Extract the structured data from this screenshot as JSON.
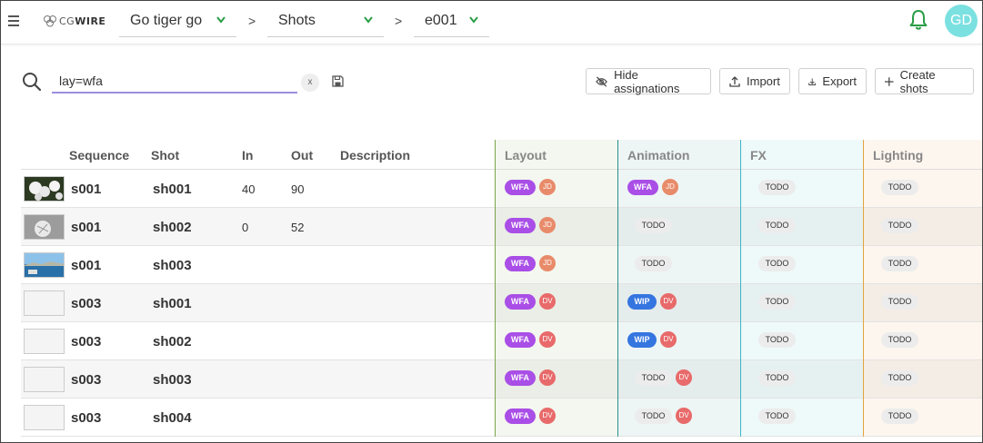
{
  "header": {
    "menu_icon": "hamburger-icon",
    "logo": {
      "prefix": "CG",
      "suffix": "WIRE",
      "icon": "logo-icon"
    },
    "production": "Go tiger go",
    "section": "Shots",
    "episode": "e001",
    "separator": ">",
    "avatar_initials": "GD",
    "colors": {
      "avatar": "#7be0e0",
      "bell": "#2a9d46",
      "chevron": "#2a9d46"
    }
  },
  "search": {
    "value": "lay=wfa",
    "clear_label": "x",
    "icon": "search-icon",
    "save_icon": "save-icon"
  },
  "toolbar": {
    "hide_assignations": "Hide assignations",
    "import": "Import",
    "export": "Export",
    "create_shots": "Create shots"
  },
  "columns": {
    "sequence": "Sequence",
    "shot": "Shot",
    "in": "In",
    "out": "Out",
    "description": "Description",
    "layout": "Layout",
    "animation": "Animation",
    "fx": "FX",
    "lighting": "Lighting"
  },
  "task_colors": {
    "layout": "#7ca34b",
    "animation": "#2a8f8f",
    "fx": "#3cb6c6",
    "lighting": "#e4a440"
  },
  "status_colors": {
    "WFA": "#a94ee6",
    "WIP": "#3575e0",
    "TODO": "#ececec"
  },
  "rows": [
    {
      "thumb": "flowers",
      "sequence": "s001",
      "shot": "sh001",
      "in": "40",
      "out": "90",
      "layout": {
        "status": "WFA",
        "person": "JD"
      },
      "animation": {
        "status": "WFA",
        "person": "JD"
      },
      "fx": {
        "status": "TODO",
        "person": ""
      },
      "lighting": {
        "status": "TODO",
        "person": ""
      }
    },
    {
      "thumb": "ice",
      "sequence": "s001",
      "shot": "sh002",
      "in": "0",
      "out": "52",
      "layout": {
        "status": "WFA",
        "person": "JD"
      },
      "animation": {
        "status": "TODO",
        "person": ""
      },
      "fx": {
        "status": "TODO",
        "person": ""
      },
      "lighting": {
        "status": "TODO",
        "person": ""
      }
    },
    {
      "thumb": "sea",
      "sequence": "s001",
      "shot": "sh003",
      "in": "",
      "out": "",
      "layout": {
        "status": "WFA",
        "person": "JD"
      },
      "animation": {
        "status": "TODO",
        "person": ""
      },
      "fx": {
        "status": "TODO",
        "person": ""
      },
      "lighting": {
        "status": "TODO",
        "person": ""
      }
    },
    {
      "thumb": "empty",
      "sequence": "s003",
      "shot": "sh001",
      "in": "",
      "out": "",
      "layout": {
        "status": "WFA",
        "person": "DV"
      },
      "animation": {
        "status": "WIP",
        "person": "DV"
      },
      "fx": {
        "status": "TODO",
        "person": ""
      },
      "lighting": {
        "status": "TODO",
        "person": ""
      }
    },
    {
      "thumb": "empty",
      "sequence": "s003",
      "shot": "sh002",
      "in": "",
      "out": "",
      "layout": {
        "status": "WFA",
        "person": "DV"
      },
      "animation": {
        "status": "WIP",
        "person": "DV"
      },
      "fx": {
        "status": "TODO",
        "person": ""
      },
      "lighting": {
        "status": "TODO",
        "person": ""
      }
    },
    {
      "thumb": "empty",
      "sequence": "s003",
      "shot": "sh003",
      "in": "",
      "out": "",
      "layout": {
        "status": "WFA",
        "person": "DV"
      },
      "animation": {
        "status": "TODO",
        "person": "DV"
      },
      "fx": {
        "status": "TODO",
        "person": ""
      },
      "lighting": {
        "status": "TODO",
        "person": ""
      }
    },
    {
      "thumb": "empty",
      "sequence": "s003",
      "shot": "sh004",
      "in": "",
      "out": "",
      "layout": {
        "status": "WFA",
        "person": "DV"
      },
      "animation": {
        "status": "TODO",
        "person": "DV"
      },
      "fx": {
        "status": "TODO",
        "person": ""
      },
      "lighting": {
        "status": "TODO",
        "person": ""
      }
    }
  ]
}
